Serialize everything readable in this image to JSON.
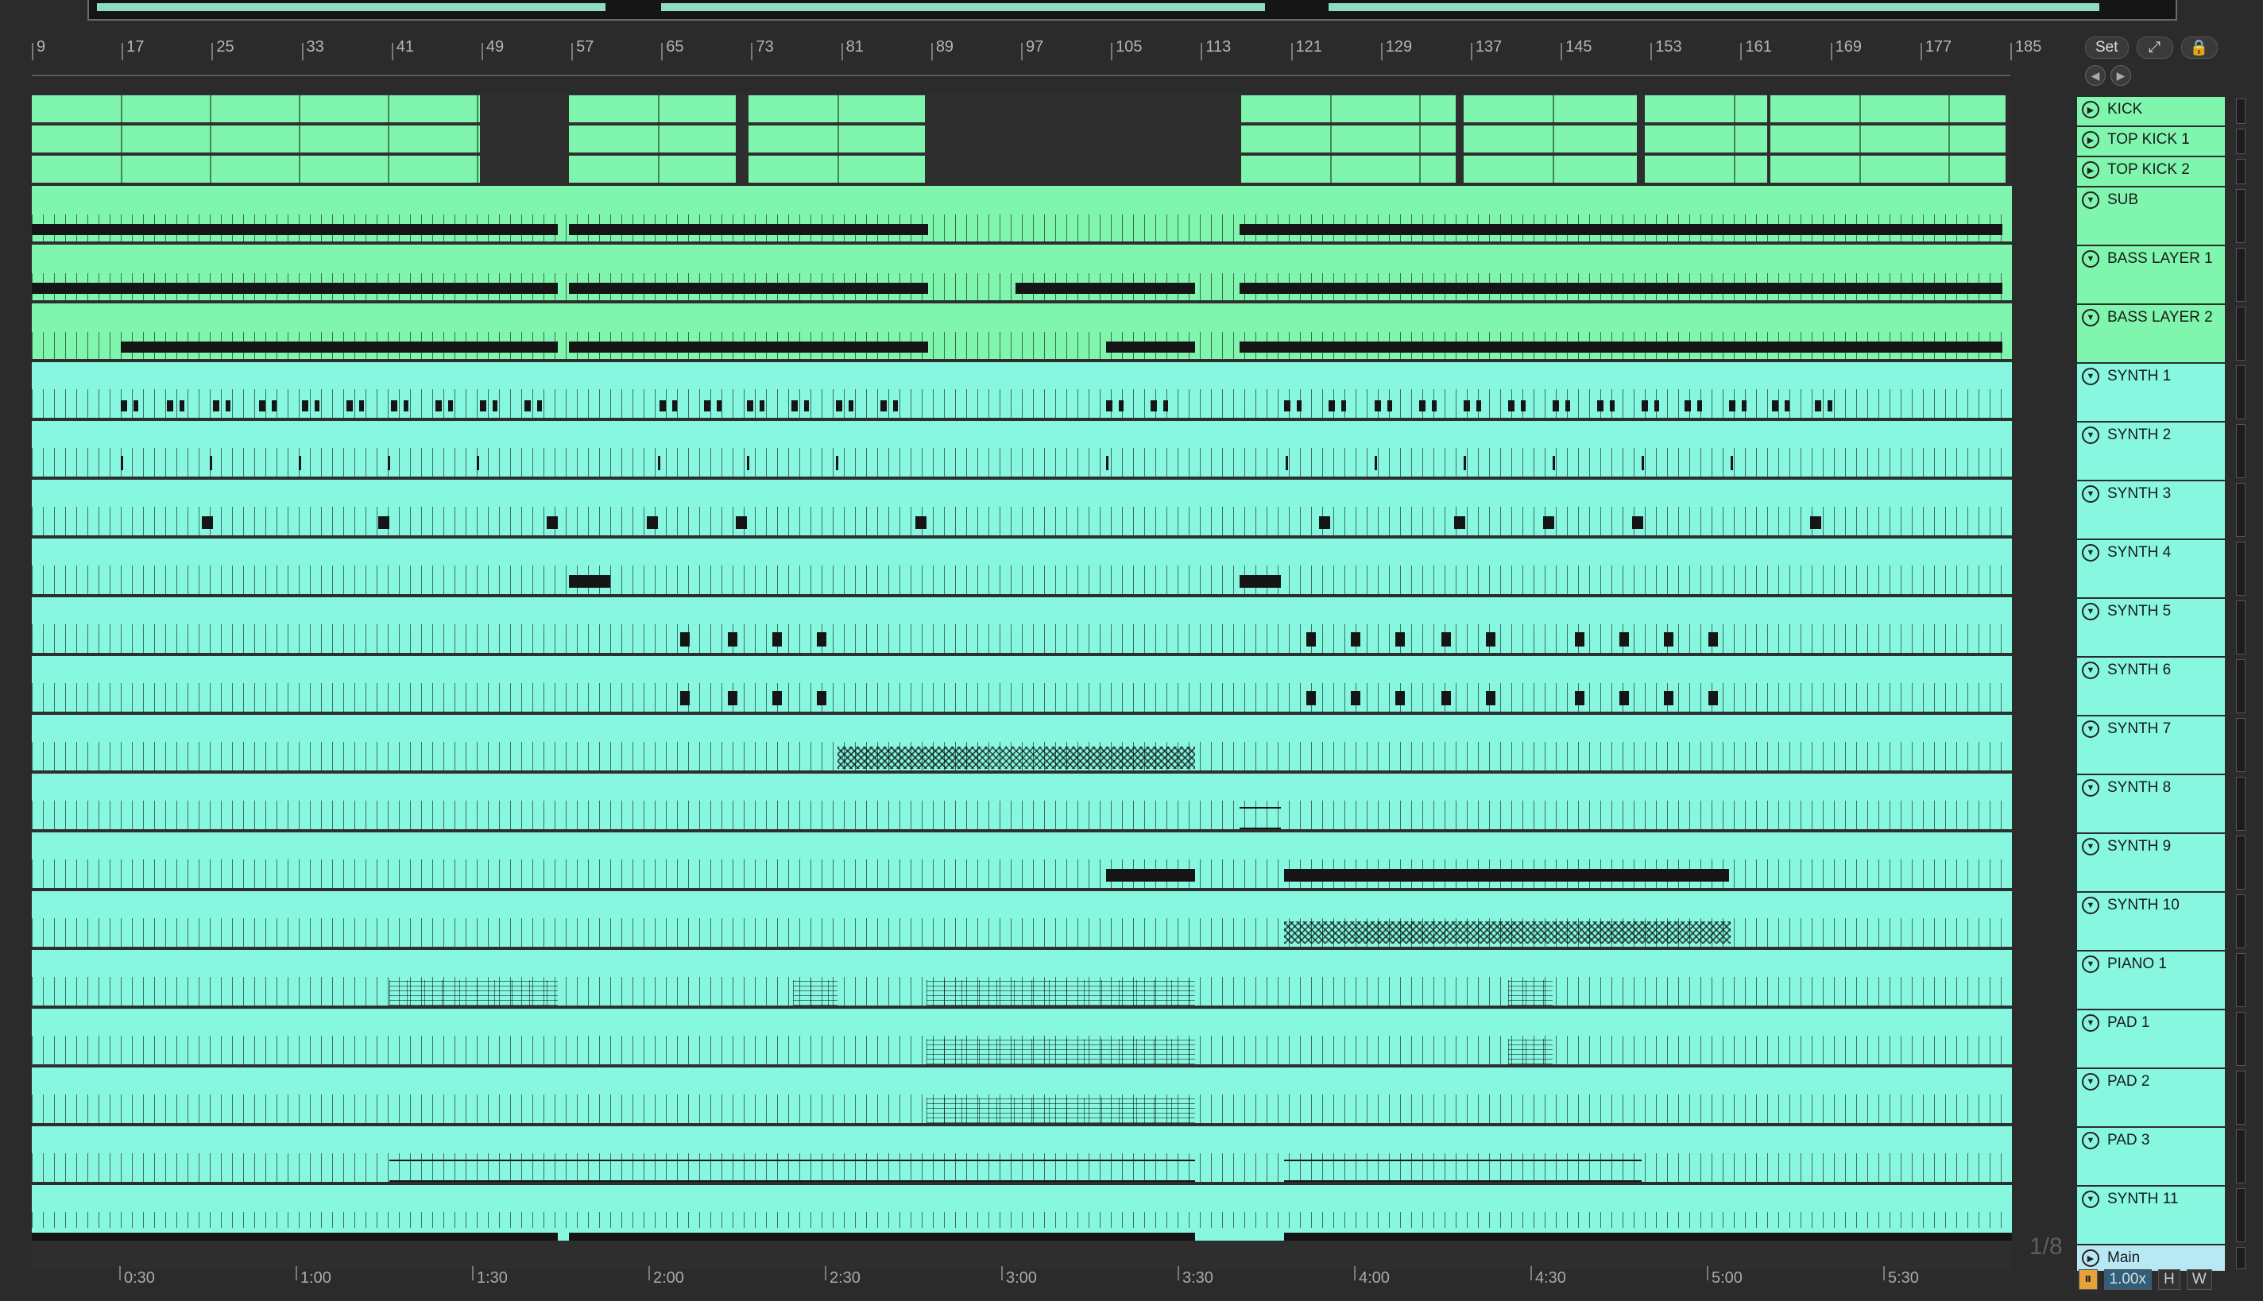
{
  "ruler": {
    "bars": [
      "9",
      "17",
      "25",
      "33",
      "41",
      "49",
      "57",
      "65",
      "73",
      "81",
      "89",
      "97",
      "105",
      "113",
      "121",
      "129",
      "137",
      "145",
      "153",
      "161",
      "169",
      "177",
      "185"
    ]
  },
  "time_ruler": [
    "0:30",
    "1:00",
    "1:30",
    "2:00",
    "2:30",
    "3:00",
    "3:30",
    "4:00",
    "4:30",
    "5:00",
    "5:30"
  ],
  "controls": {
    "set_label": "Set",
    "expand_icon": "expand-icon",
    "lock_icon": "lock-icon",
    "back_icon": "arrow-left-icon",
    "forward_icon": "arrow-right-icon"
  },
  "zoom_fraction": "1/8",
  "tempo_factor": "1.00x",
  "h_label": "H",
  "w_label": "W",
  "colors": {
    "green_clip": "#7ff5ad",
    "cyan_clip": "#87f7e0",
    "main_track": "#b7e8f4",
    "background": "#2b2b2b"
  },
  "tracks": [
    {
      "name": "KICK",
      "type": "green",
      "state": "collapsed"
    },
    {
      "name": "TOP KICK 1",
      "type": "green",
      "state": "collapsed"
    },
    {
      "name": "TOP KICK 2",
      "type": "green",
      "state": "collapsed"
    },
    {
      "name": "SUB",
      "type": "green",
      "state": "expanded"
    },
    {
      "name": "BASS LAYER 1",
      "type": "green",
      "state": "expanded"
    },
    {
      "name": "BASS LAYER 2",
      "type": "green",
      "state": "expanded"
    },
    {
      "name": "SYNTH 1",
      "type": "cyan",
      "state": "expanded"
    },
    {
      "name": "SYNTH 2",
      "type": "cyan",
      "state": "expanded"
    },
    {
      "name": "SYNTH 3",
      "type": "cyan",
      "state": "expanded"
    },
    {
      "name": "SYNTH 4",
      "type": "cyan",
      "state": "expanded"
    },
    {
      "name": "SYNTH 5",
      "type": "cyan",
      "state": "expanded"
    },
    {
      "name": "SYNTH 6",
      "type": "cyan",
      "state": "expanded"
    },
    {
      "name": "SYNTH 7",
      "type": "cyan",
      "state": "expanded"
    },
    {
      "name": "SYNTH 8",
      "type": "cyan",
      "state": "expanded"
    },
    {
      "name": "SYNTH 9",
      "type": "cyan",
      "state": "expanded"
    },
    {
      "name": "SYNTH 10",
      "type": "cyan",
      "state": "expanded"
    },
    {
      "name": "PIANO 1",
      "type": "cyan",
      "state": "expanded"
    },
    {
      "name": "PAD 1",
      "type": "cyan",
      "state": "expanded"
    },
    {
      "name": "PAD 2",
      "type": "cyan",
      "state": "expanded"
    },
    {
      "name": "PAD 3",
      "type": "cyan",
      "state": "expanded"
    },
    {
      "name": "SYNTH 11",
      "type": "cyan",
      "state": "expanded"
    },
    {
      "name": "Main",
      "type": "main",
      "state": "collapsed"
    }
  ]
}
